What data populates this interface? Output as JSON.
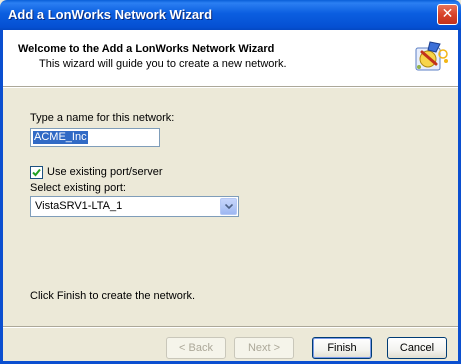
{
  "window": {
    "title": "Add a LonWorks Network Wizard",
    "close_glyph": "✕"
  },
  "header": {
    "title": "Welcome to the Add a LonWorks Network Wizard",
    "subtitle": "This wizard will guide you to create a new network.",
    "icon": "wizard-hat-icon"
  },
  "form": {
    "name_label": "Type a name for this network:",
    "name_value": "ACME_Inc",
    "use_existing_label": "Use existing port/server",
    "use_existing_checked": true,
    "port_label": "Select existing port:",
    "port_value": "VistaSRV1-LTA_1"
  },
  "footer_text": "Click Finish to create the network.",
  "buttons": {
    "back": "< Back",
    "next": "Next >",
    "finish": "Finish",
    "cancel": "Cancel"
  },
  "colors": {
    "titlebar": "#0b5ee0",
    "dialog_bg": "#ece9d8",
    "selection": "#316ac5"
  }
}
